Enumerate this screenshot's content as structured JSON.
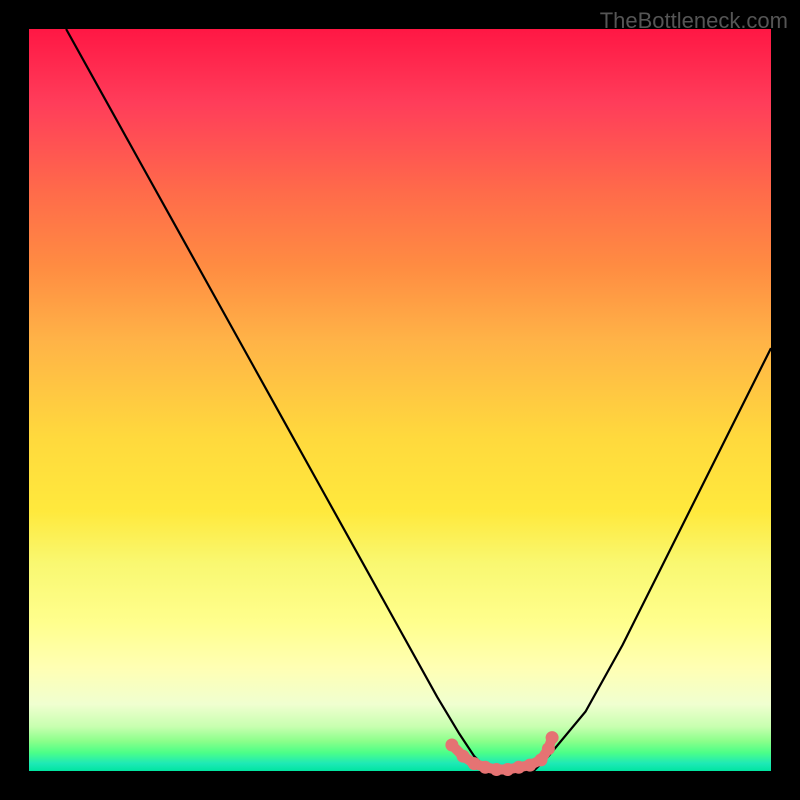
{
  "watermark": "TheBottleneck.com",
  "chart_data": {
    "type": "line",
    "title": "",
    "xlabel": "",
    "ylabel": "",
    "xlim": [
      0,
      100
    ],
    "ylim": [
      0,
      100
    ],
    "series": [
      {
        "name": "bottleneck-curve",
        "x": [
          5,
          10,
          15,
          20,
          25,
          30,
          35,
          40,
          45,
          50,
          55,
          58,
          60,
          62,
          65,
          68,
          70,
          75,
          80,
          85,
          90,
          95,
          100
        ],
        "y": [
          100,
          91,
          82,
          73,
          64,
          55,
          46,
          37,
          28,
          19,
          10,
          5,
          2,
          0,
          0,
          0,
          2,
          8,
          17,
          27,
          37,
          47,
          57
        ]
      }
    ],
    "markers": {
      "name": "highlight-dots",
      "x": [
        57,
        58.5,
        60,
        61.5,
        63,
        64.5,
        66,
        67.5,
        69,
        70,
        70.5
      ],
      "y": [
        3.5,
        2,
        1,
        0.5,
        0.2,
        0.2,
        0.5,
        0.8,
        1.5,
        3,
        4.5
      ],
      "color": "#e57373"
    },
    "gradient_stops": [
      {
        "pos": 0,
        "color": "#ff1744"
      },
      {
        "pos": 55,
        "color": "#ffd93d"
      },
      {
        "pos": 86,
        "color": "#ffffb3"
      },
      {
        "pos": 100,
        "color": "#00e5a0"
      }
    ]
  }
}
